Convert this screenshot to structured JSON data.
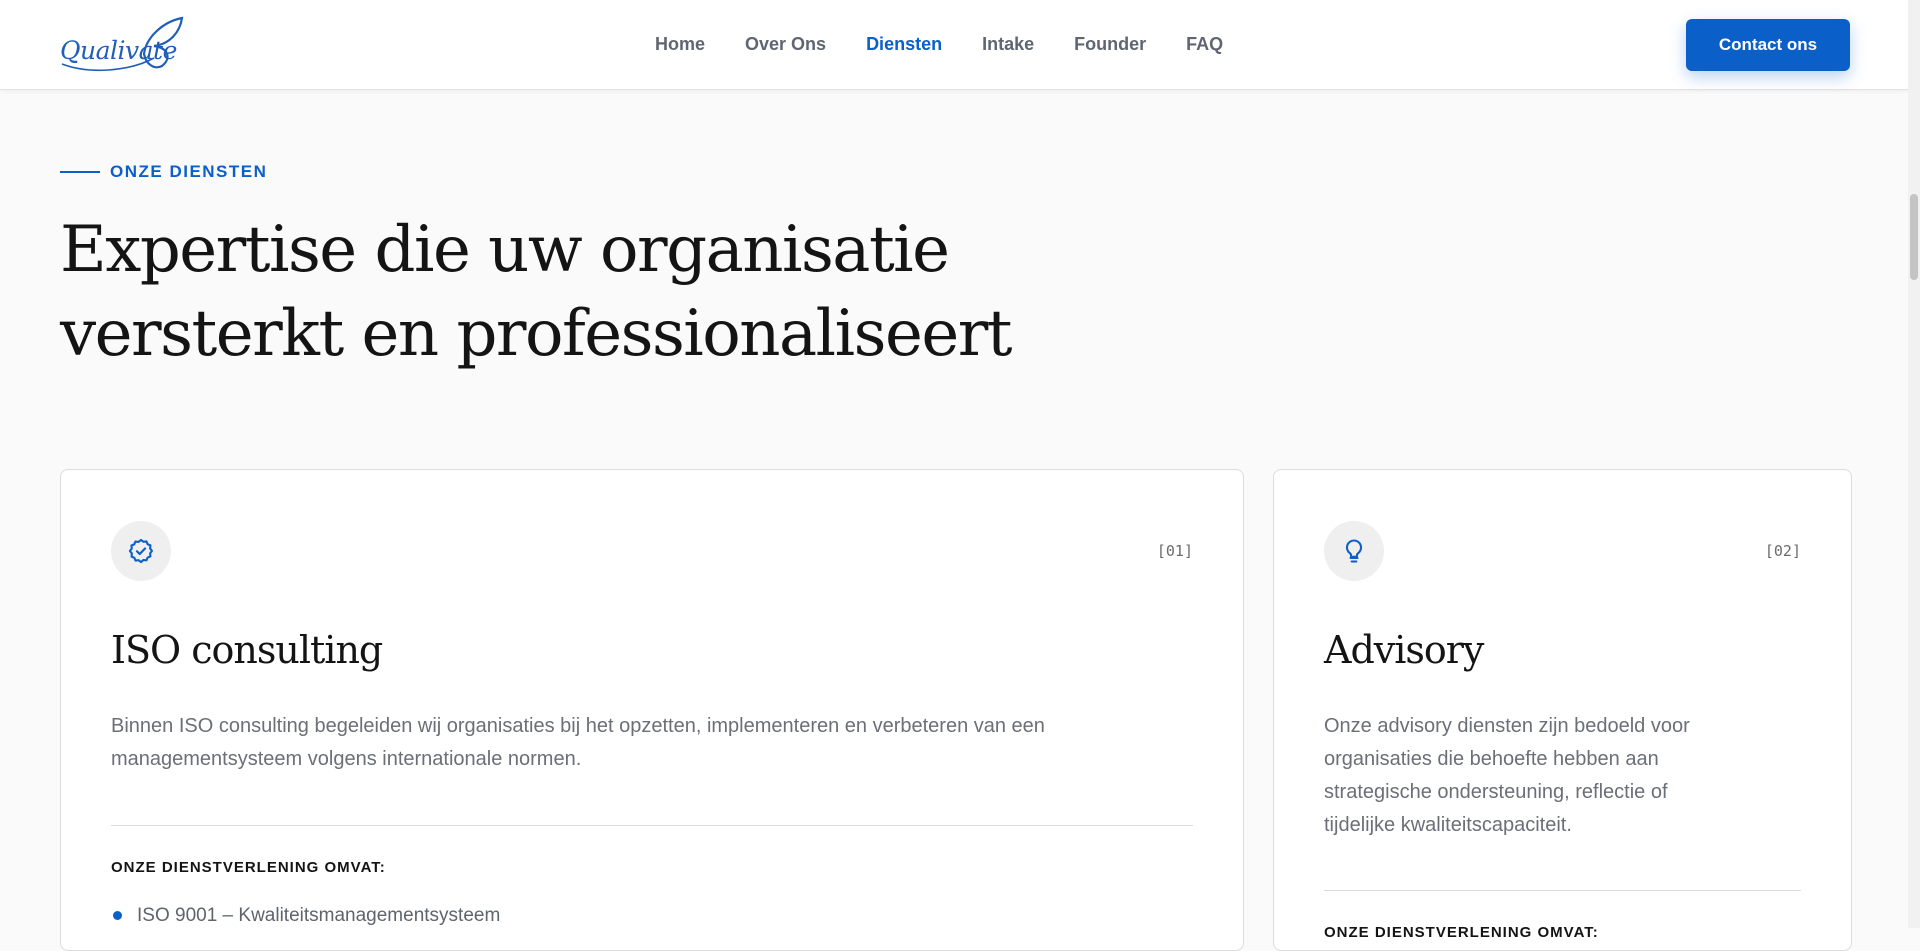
{
  "brand": {
    "logo_text": "Qualivate",
    "logo_icon": "butterfly-icon"
  },
  "nav": {
    "items": [
      {
        "label": "Home"
      },
      {
        "label": "Over Ons"
      },
      {
        "label": "Diensten",
        "active": true
      },
      {
        "label": "Intake"
      },
      {
        "label": "Founder"
      },
      {
        "label": "FAQ"
      }
    ],
    "cta_label": "Contact ons"
  },
  "section": {
    "eyebrow": "ONZE DIENSTEN",
    "headline_line1": "Expertise die uw organisatie",
    "headline_line2": "versterkt en professionaliseert"
  },
  "cards": [
    {
      "number": "[01]",
      "icon": "badge-check-icon",
      "title": "ISO consulting",
      "description": "Binnen ISO consulting begeleiden wij organisaties bij het opzetten, implementeren en verbeteren van een managementsysteem volgens internationale normen.",
      "subhead": "ONZE DIENSTVERLENING OMVAT:",
      "items": [
        "ISO 9001 – Kwaliteitsmanagementsysteem"
      ]
    },
    {
      "number": "[02]",
      "icon": "lightbulb-icon",
      "title": "Advisory",
      "description": "Onze advisory diensten zijn bedoeld voor organisaties die behoefte hebben aan strategische ondersteuning, reflectie of tijdelijke kwaliteitscapaciteit.",
      "subhead": "ONZE DIENSTVERLENING OMVAT:"
    }
  ],
  "colors": {
    "accent": "#0b5fc9",
    "background": "#fafafa",
    "card": "#ffffff",
    "text_muted": "#6b6f76"
  }
}
